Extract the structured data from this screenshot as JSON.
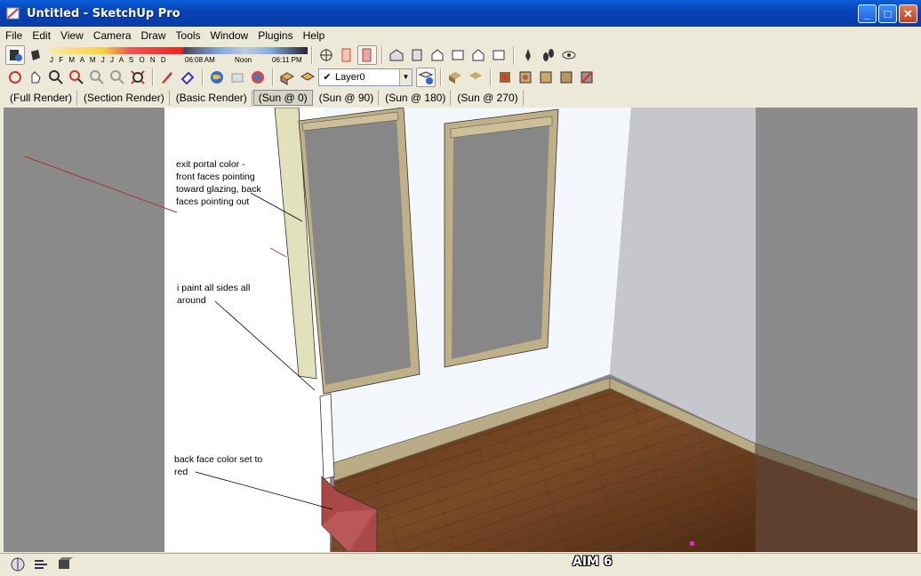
{
  "window": {
    "title": "Untitled - SketchUp Pro",
    "buttons": [
      "minimize",
      "maximize",
      "close"
    ]
  },
  "menu": [
    "File",
    "Edit",
    "View",
    "Camera",
    "Draw",
    "Tools",
    "Window",
    "Plugins",
    "Help"
  ],
  "shadow_settings": {
    "months": "J F M A M J J A S O N D",
    "time_start": "06:08 AM",
    "time_mid": "Noon",
    "time_end": "06:11 PM"
  },
  "layer": {
    "current": "Layer0"
  },
  "scene_tabs": [
    {
      "label": "(Full Render)",
      "active": false
    },
    {
      "label": "(Section Render)",
      "active": false
    },
    {
      "label": "(Basic Render)",
      "active": false
    },
    {
      "label": "(Sun @ 0)",
      "active": true
    },
    {
      "label": "(Sun @ 90)",
      "active": false
    },
    {
      "label": "(Sun @ 180)",
      "active": false
    },
    {
      "label": "(Sun @ 270)",
      "active": false
    }
  ],
  "annotations": {
    "note1": [
      "exit portal color -",
      "front faces pointing",
      "toward glazing, back",
      "faces pointing out"
    ],
    "note2": [
      "i paint all sides all",
      "around"
    ],
    "note3": [
      "back face color set to",
      "red"
    ]
  },
  "status": {
    "watermark": "AIM 6"
  },
  "colors": {
    "titlebar": "#0a4fd0",
    "backface": "#a84848",
    "floor": "#6b3e22",
    "trim": "#b9ab86"
  }
}
